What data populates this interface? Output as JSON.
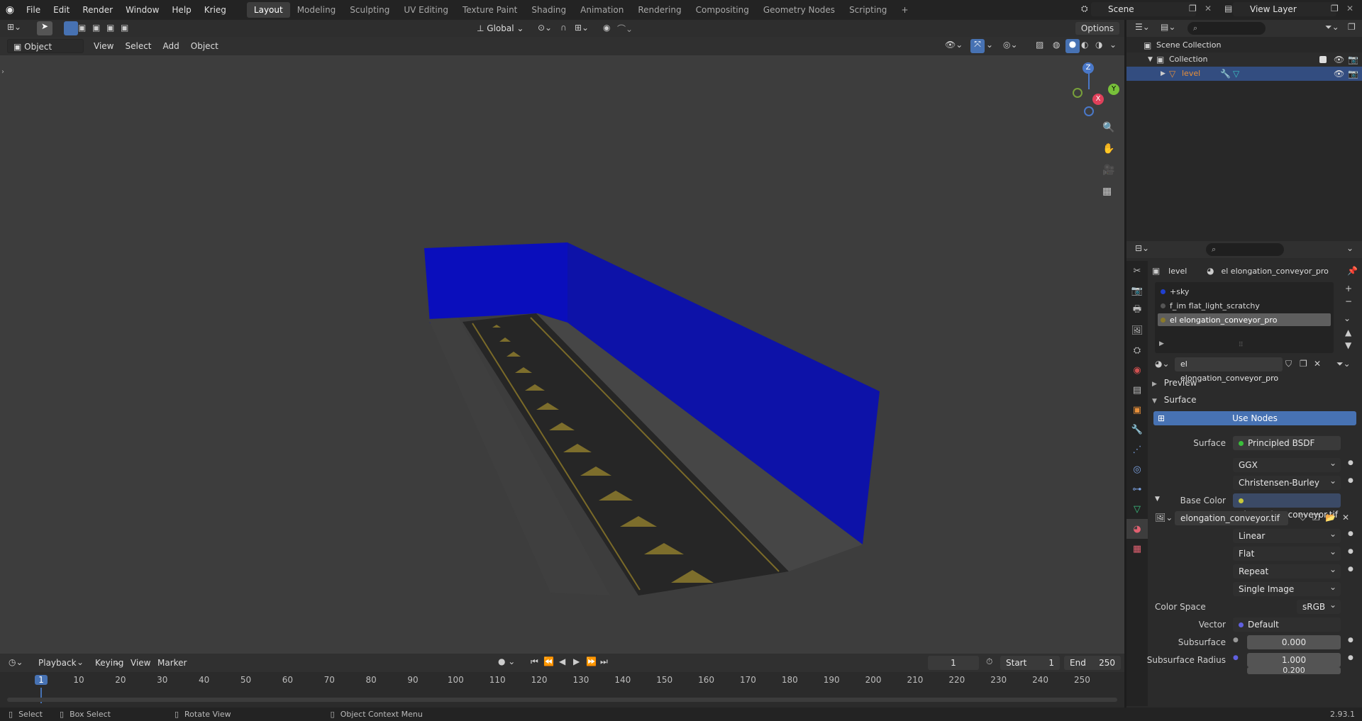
{
  "topbar": {
    "menus": [
      "File",
      "Edit",
      "Render",
      "Window",
      "Help",
      "Krieg"
    ],
    "workspaces": [
      "Layout",
      "Modeling",
      "Sculpting",
      "UV Editing",
      "Texture Paint",
      "Shading",
      "Animation",
      "Rendering",
      "Compositing",
      "Geometry Nodes",
      "Scripting"
    ],
    "active_workspace": "Layout",
    "add_tab": "+",
    "scene": "Scene",
    "view_layer": "View Layer"
  },
  "viewport_toolbar": {
    "orientation": "Global",
    "options": "Options"
  },
  "viewport_header": {
    "mode": "Object Mode",
    "menus": [
      "View",
      "Select",
      "Add",
      "Object"
    ]
  },
  "gizmo": {
    "z": "Z",
    "y": "Y",
    "x": "X"
  },
  "outliner": {
    "items": [
      {
        "label": "Scene Collection"
      },
      {
        "label": "Collection"
      },
      {
        "label": "level"
      }
    ]
  },
  "properties": {
    "breadcrumb_object": "level",
    "breadcrumb_material": "el elongation_conveyor_pro",
    "material_slots": [
      "+sky",
      "f_im flat_light_scratchy",
      "el elongation_conveyor_pro"
    ],
    "material_name": "el elongation_conveyor_pro",
    "panel_preview": "Preview",
    "panel_surface": "Surface",
    "use_nodes": "Use Nodes",
    "surface_label": "Surface",
    "surface_value": "Principled BSDF",
    "distribution": "GGX",
    "subsurface_method": "Christensen-Burley",
    "base_color_label": "Base Color",
    "base_color_value": "elongation_conveyor.tif",
    "image_name": "elongation_conveyor.tif",
    "interpolation": "Linear",
    "projection": "Flat",
    "extension": "Repeat",
    "source": "Single Image",
    "color_space_label": "Color Space",
    "color_space": "sRGB",
    "vector_label": "Vector",
    "vector_value": "Default",
    "subsurface_label": "Subsurface",
    "subsurface_value": "0.000",
    "subsurface_radius_label": "Subsurface Radius",
    "subsurface_radius_1": "1.000",
    "subsurface_radius_2": "0.200"
  },
  "timeline": {
    "menus": [
      "Playback",
      "Keying",
      "View",
      "Marker"
    ],
    "current_frame": "1",
    "start_label": "Start",
    "start": "1",
    "end_label": "End",
    "end": "250",
    "ticks": [
      "1",
      "10",
      "20",
      "30",
      "40",
      "50",
      "60",
      "70",
      "80",
      "90",
      "100",
      "110",
      "120",
      "130",
      "140",
      "150",
      "160",
      "170",
      "180",
      "190",
      "200",
      "210",
      "220",
      "230",
      "240",
      "250"
    ]
  },
  "statusbar": {
    "select": "Select",
    "box_select": "Box Select",
    "rotate_view": "Rotate View",
    "context_menu": "Object Context Menu",
    "version": "2.93.1"
  },
  "colors": {
    "accent": "#4772b3",
    "wall": "#0a0fb0",
    "arrow": "#8a7a2a",
    "viewport_bg": "#3d3d3d"
  }
}
